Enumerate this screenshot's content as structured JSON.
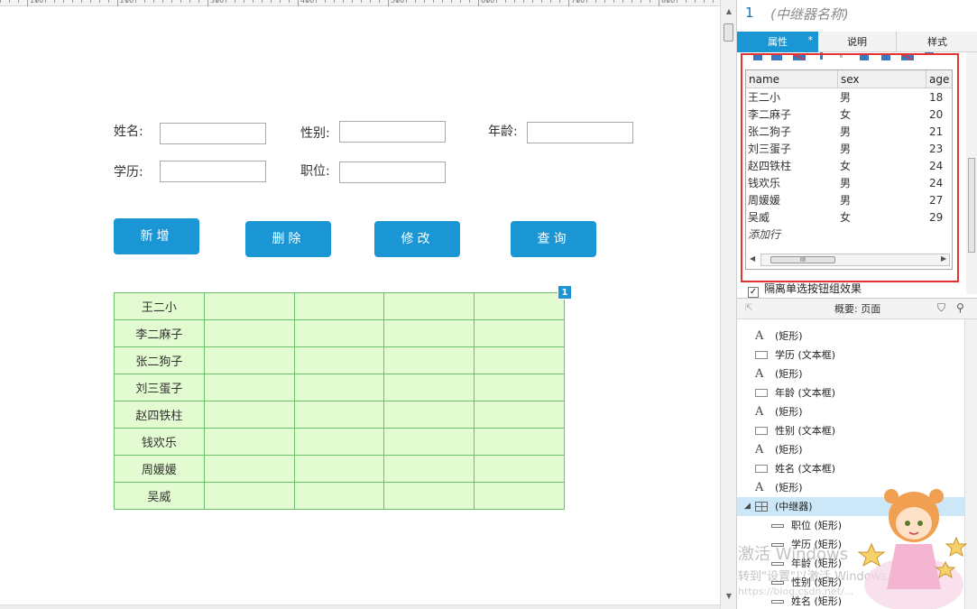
{
  "ruler": {
    "labels": [
      "100",
      "200",
      "300",
      "400",
      "500",
      "600",
      "700",
      "800"
    ]
  },
  "form": {
    "name_label": "姓名:",
    "sex_label": "性别:",
    "age_label": "年龄:",
    "education_label": "学历:",
    "position_label": "职位:",
    "name_value": "",
    "sex_value": "",
    "age_value": "",
    "education_value": "",
    "position_value": ""
  },
  "buttons": {
    "add": "新增",
    "delete": "删除",
    "edit": "修改",
    "query": "查询"
  },
  "repeater_grid": {
    "badge": "1",
    "names": [
      "王二小",
      "李二麻子",
      "张二狗子",
      "刘三蛋子",
      "赵四铁柱",
      "钱欢乐",
      "周媛媛",
      "吴威"
    ]
  },
  "panel": {
    "item_number": "1",
    "widget_name": "(中继器名称)",
    "tabs": {
      "properties": "属性",
      "properties_star": "*",
      "notes": "说明",
      "style": "样式"
    },
    "dataset": {
      "columns": [
        "name",
        "sex",
        "age"
      ],
      "rows": [
        {
          "name": "王二小",
          "sex": "男",
          "age": "18"
        },
        {
          "name": "李二麻子",
          "sex": "女",
          "age": "20"
        },
        {
          "name": "张二狗子",
          "sex": "男",
          "age": "21"
        },
        {
          "name": "刘三蛋子",
          "sex": "男",
          "age": "23"
        },
        {
          "name": "赵四铁柱",
          "sex": "女",
          "age": "24"
        },
        {
          "name": "钱欢乐",
          "sex": "男",
          "age": "24"
        },
        {
          "name": "周媛媛",
          "sex": "男",
          "age": "27"
        },
        {
          "name": "吴威",
          "sex": "女",
          "age": "29"
        }
      ],
      "add_row": "添加行",
      "scroll_glyph": "III"
    },
    "isolate_option": {
      "checked": true,
      "label": "隔离单选按钮组效果",
      "check_glyph": "✓"
    },
    "outline": {
      "title": "概要: 页面",
      "items": [
        {
          "type": "text",
          "label": "(矩形)"
        },
        {
          "type": "box",
          "label": "学历 (文本框)"
        },
        {
          "type": "text",
          "label": "(矩形)"
        },
        {
          "type": "box",
          "label": "年龄 (文本框)"
        },
        {
          "type": "text",
          "label": "(矩形)"
        },
        {
          "type": "box",
          "label": "性别 (文本框)"
        },
        {
          "type": "text",
          "label": "(矩形)"
        },
        {
          "type": "box",
          "label": "姓名 (文本框)"
        },
        {
          "type": "text",
          "label": "(矩形)"
        },
        {
          "type": "repeater",
          "label": "(中继器)"
        },
        {
          "type": "line",
          "label": "职位 (矩形)"
        },
        {
          "type": "line",
          "label": "学历 (矩形)"
        },
        {
          "type": "line",
          "label": "年龄 (矩形)"
        },
        {
          "type": "line",
          "label": "性别 (矩形)"
        },
        {
          "type": "line",
          "label": "姓名 (矩形)"
        }
      ]
    }
  },
  "watermark": {
    "line1": "激活 Windows",
    "line2": "转到\"设置\"以激活 Windows。",
    "line3": "https://blog.csdn.net/..."
  },
  "colors": {
    "accent": "#1a96d4",
    "grid_fill": "#e3fbd0",
    "grid_border": "#6cc26c",
    "highlight_box": "#e53333",
    "selected_row": "#cbe7f8"
  }
}
